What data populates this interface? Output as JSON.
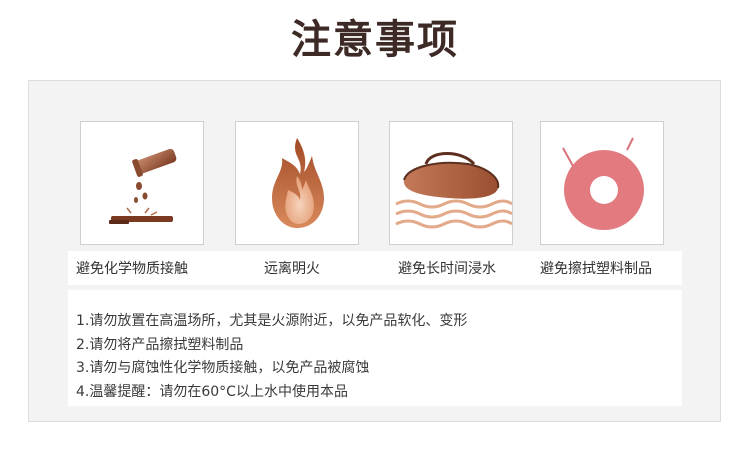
{
  "title": "注意事项",
  "icons": [
    {
      "name": "chemical-icon",
      "caption": "避免化学物质接触"
    },
    {
      "name": "fire-icon",
      "caption": "远离明火"
    },
    {
      "name": "soak-icon",
      "caption": "避免长时间浸水"
    },
    {
      "name": "plastic-icon",
      "caption": "避免擦拭塑料制品"
    }
  ],
  "notes": [
    "1.请勿放置在高温场所，尤其是火源附近，以免产品软化、变形",
    "2.请勿将产品擦拭塑料制品",
    "3.请勿与腐蚀性化学物质接触，以免产品被腐蚀",
    "4.温馨提醒：请勿在60°C以上水中使用本品"
  ],
  "colors": {
    "title": "#3d2a26",
    "icon_brown": "#a35a3e",
    "icon_light": "#e6b08d",
    "icon_pink": "#e0737a"
  }
}
